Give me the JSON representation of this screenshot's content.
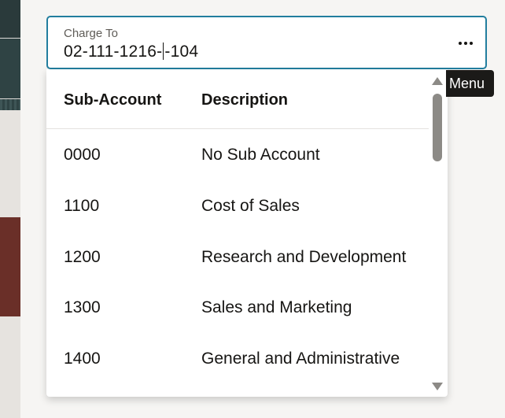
{
  "field": {
    "label": "Charge To",
    "value_before_caret": "02-111-1216-",
    "value_after_caret": "-104",
    "more_icon": "more-horizontal-icon"
  },
  "tooltip": {
    "text": "Menu"
  },
  "dropdown": {
    "headers": [
      "Sub-Account",
      "Description"
    ],
    "rows": [
      {
        "code": "0000",
        "description": "No Sub Account"
      },
      {
        "code": "1100",
        "description": "Cost of Sales"
      },
      {
        "code": "1200",
        "description": "Research and Development"
      },
      {
        "code": "1300",
        "description": "Sales and Marketing"
      },
      {
        "code": "1400",
        "description": "General and Administrative"
      }
    ]
  },
  "colors": {
    "field_border": "#227e9e",
    "tooltip_bg": "#1b1a18",
    "scrollbar": "#8c8a86"
  }
}
